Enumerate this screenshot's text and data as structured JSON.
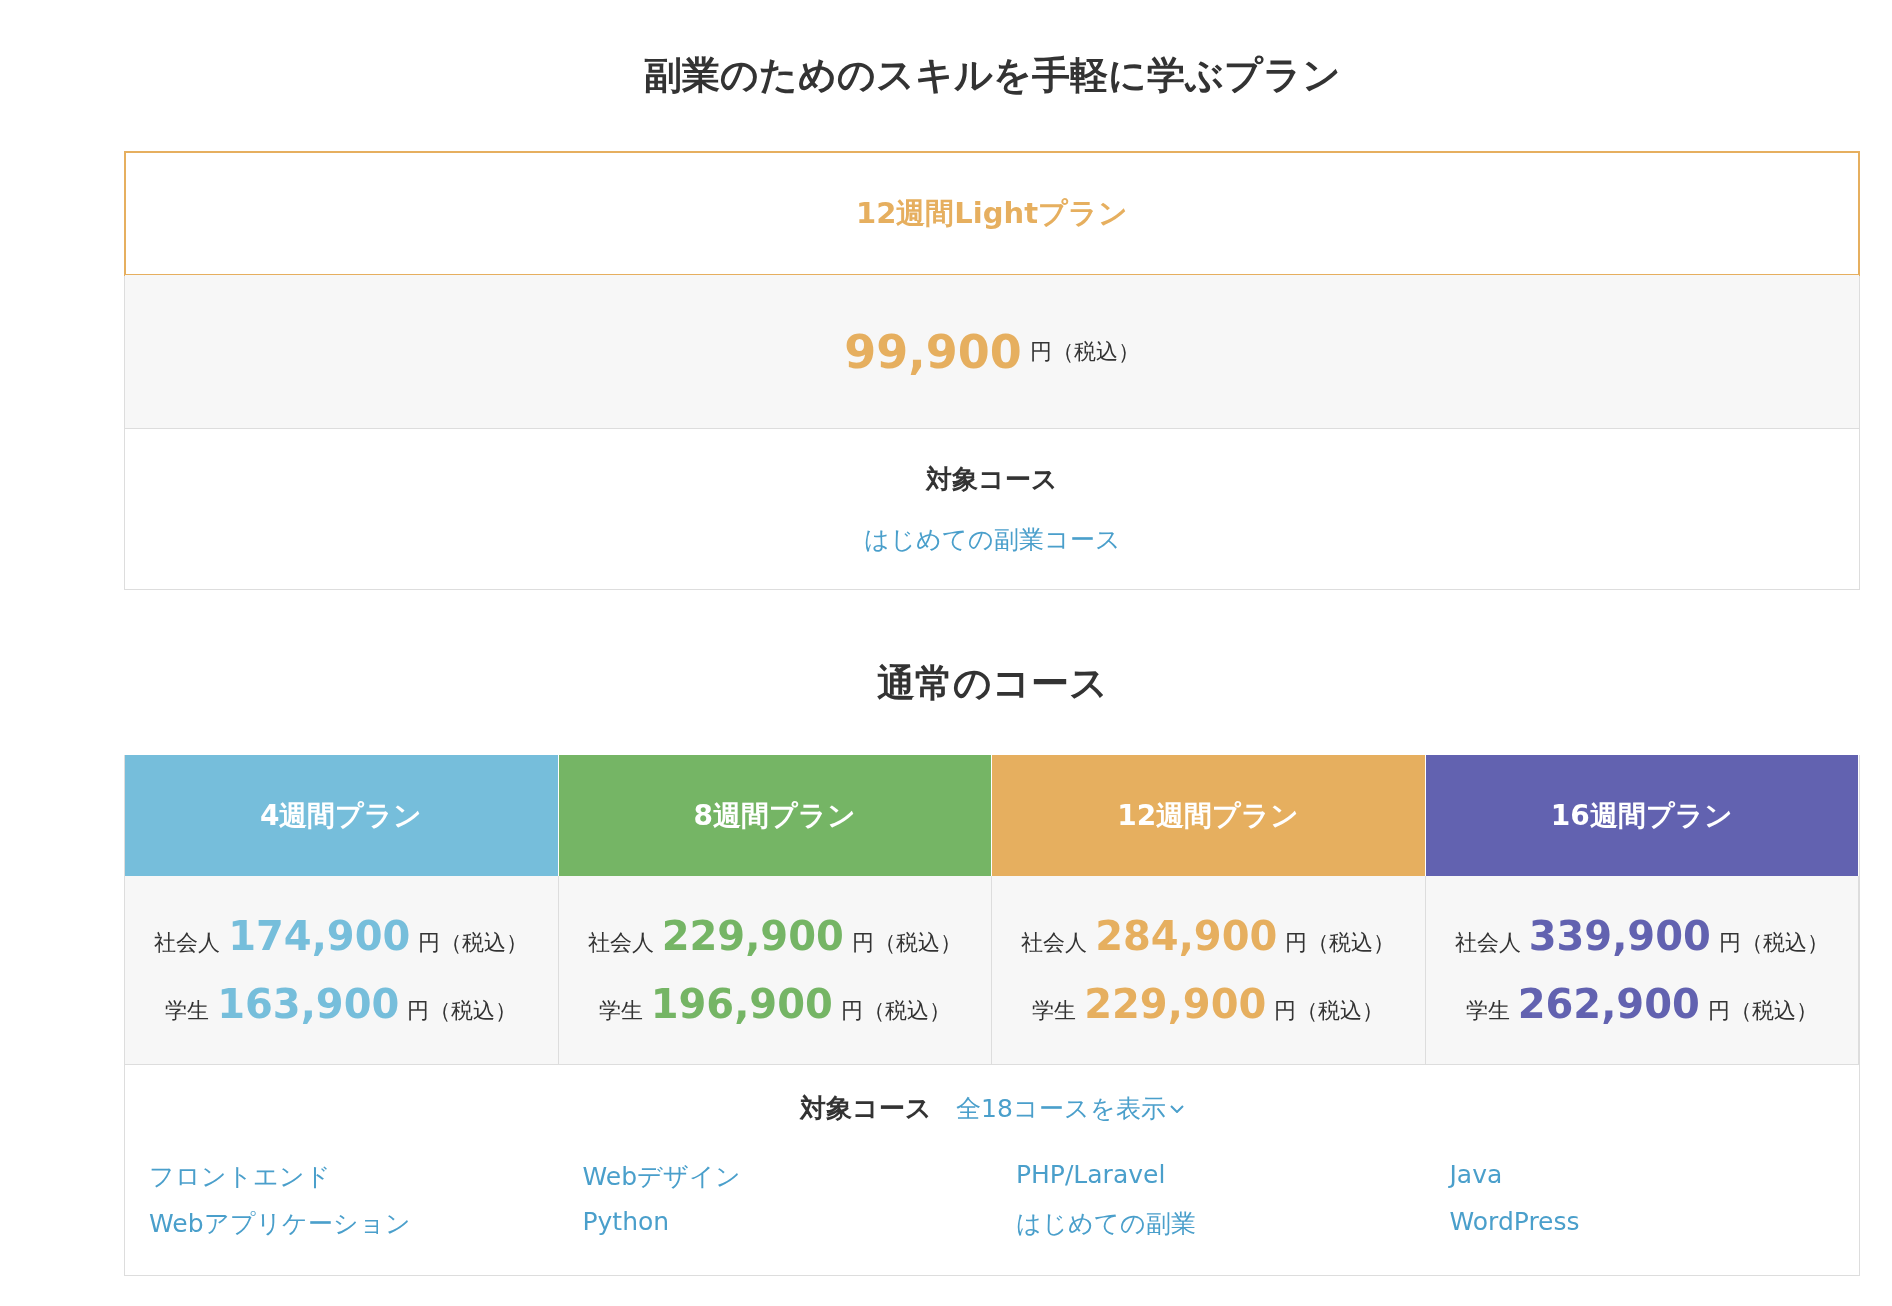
{
  "light_section": {
    "title": "副業のためのスキルを手軽に学ぶプラン",
    "plan": {
      "name": "12週間Lightプラン",
      "amount": "99,900",
      "suffix": "円（税込）",
      "course_heading": "対象コース",
      "courses": [
        "はじめての副業コース"
      ]
    }
  },
  "regular_section": {
    "title": "通常のコース",
    "plans": [
      {
        "name": "4週間プラン",
        "color": "#76bedb",
        "prices": [
          {
            "label": "社会人",
            "amount": "174,900",
            "suffix": "円（税込）"
          },
          {
            "label": "学生",
            "amount": "163,900",
            "suffix": "円（税込）"
          }
        ]
      },
      {
        "name": "8週間プラン",
        "color": "#75b565",
        "prices": [
          {
            "label": "社会人",
            "amount": "229,900",
            "suffix": "円（税込）"
          },
          {
            "label": "学生",
            "amount": "196,900",
            "suffix": "円（税込）"
          }
        ]
      },
      {
        "name": "12週間プラン",
        "color": "#e6af5f",
        "prices": [
          {
            "label": "社会人",
            "amount": "284,900",
            "suffix": "円（税込）"
          },
          {
            "label": "学生",
            "amount": "229,900",
            "suffix": "円（税込）"
          }
        ]
      },
      {
        "name": "16週間プラン",
        "color": "#6262b0",
        "prices": [
          {
            "label": "社会人",
            "amount": "339,900",
            "suffix": "円（税込）"
          },
          {
            "label": "学生",
            "amount": "262,900",
            "suffix": "円（税込）"
          }
        ]
      }
    ],
    "course_heading": "対象コース",
    "show_all": "全18コースを表示",
    "courses": [
      "フロントエンド",
      "Webデザイン",
      "PHP/Laravel",
      "Java",
      "Webアプリケーション",
      "Python",
      "はじめての副業",
      "WordPress"
    ]
  }
}
